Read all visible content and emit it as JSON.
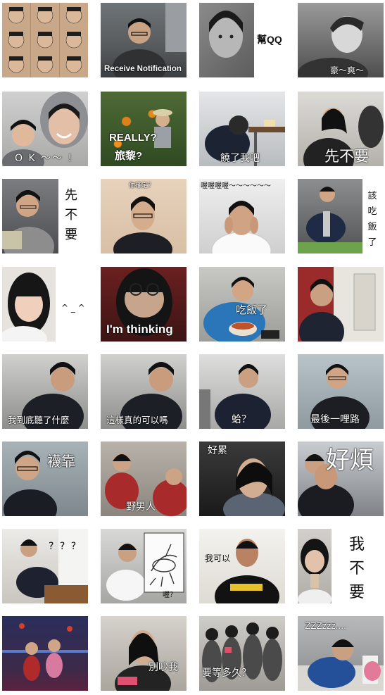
{
  "stickers": [
    {
      "caption": ""
    },
    {
      "caption": "Receive Notification"
    },
    {
      "caption": "幫QQ"
    },
    {
      "caption": "豪～爽～"
    },
    {
      "caption": "O K ～～ !"
    },
    {
      "caption_top": "REALLY?",
      "caption": "旅黎?"
    },
    {
      "caption": "饒了我吧"
    },
    {
      "caption": "先不要"
    },
    {
      "caption": "先不要"
    },
    {
      "caption": "你確定？"
    },
    {
      "caption": "喔喔喔喔～～～～～～"
    },
    {
      "caption": "該吃飯了"
    },
    {
      "caption": "^ _ ^"
    },
    {
      "caption": "I'm thinking"
    },
    {
      "caption": "吃飯了"
    },
    {
      "caption": ""
    },
    {
      "caption": "我到底聽了什麼"
    },
    {
      "caption": "這樣真的可以嗎"
    },
    {
      "caption": "蛤？"
    },
    {
      "caption": "最後一哩路"
    },
    {
      "caption": "襪靠"
    },
    {
      "caption": "野男人"
    },
    {
      "caption": "好累"
    },
    {
      "caption": "好煩"
    },
    {
      "caption": "? ? ?"
    },
    {
      "caption": "喔？"
    },
    {
      "caption": "我可以"
    },
    {
      "caption": "我不要"
    },
    {
      "caption": ""
    },
    {
      "caption": "別吵我"
    },
    {
      "caption": "要等多久？"
    },
    {
      "caption": "ZZZzzz...."
    }
  ]
}
